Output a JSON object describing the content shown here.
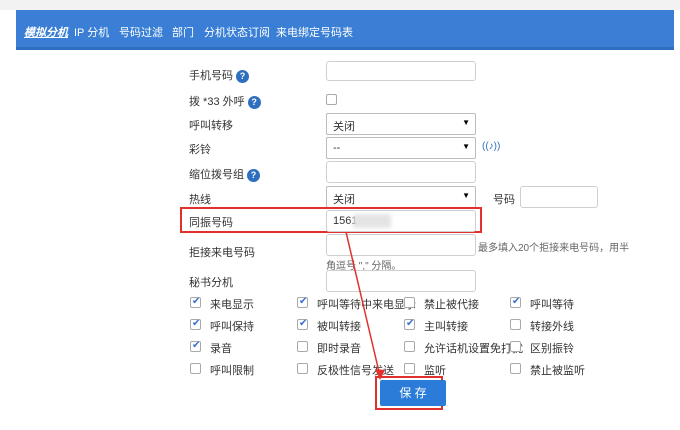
{
  "nav": {
    "items": [
      {
        "label": "模拟分机",
        "active": true
      },
      {
        "label": "IP 分机",
        "active": false
      },
      {
        "label": "号码过滤",
        "active": false
      },
      {
        "label": "部门",
        "active": false
      },
      {
        "label": "分机状态订阅",
        "active": false
      },
      {
        "label": "来电绑定号码表",
        "active": false
      }
    ]
  },
  "form": {
    "mobile": {
      "label": "手机号码",
      "value": ""
    },
    "dial33": {
      "label": "拨 *33 外呼",
      "checked": false
    },
    "forward": {
      "label": "呼叫转移",
      "value": "关闭"
    },
    "ringback": {
      "label": "彩铃",
      "value": "--"
    },
    "shortdial": {
      "label": "缩位拨号组",
      "value": ""
    },
    "hotline": {
      "label": "热线",
      "value": "关闭",
      "number_label": "号码",
      "number_value": ""
    },
    "simulring": {
      "label": "同振号码",
      "value": "1561"
    },
    "reject": {
      "label": "拒接来电号码",
      "value": "",
      "hint_line1": "最多填入20个拒接来电号码，用半",
      "hint_line2": "角逗号 \",\" 分隔。"
    },
    "secretary": {
      "label": "秘书分机",
      "value": ""
    }
  },
  "options": [
    [
      {
        "label": "来电显示",
        "checked": true
      },
      {
        "label": "呼叫等待中来电显示",
        "checked": true
      },
      {
        "label": "禁止被代接",
        "checked": false
      },
      {
        "label": "呼叫等待",
        "checked": true
      }
    ],
    [
      {
        "label": "呼叫保持",
        "checked": true
      },
      {
        "label": "被叫转接",
        "checked": true
      },
      {
        "label": "主叫转接",
        "checked": true
      },
      {
        "label": "转接外线",
        "checked": false
      }
    ],
    [
      {
        "label": "录音",
        "checked": true
      },
      {
        "label": "即时录音",
        "checked": false
      },
      {
        "label": "允许话机设置免打扰",
        "checked": false
      },
      {
        "label": "区别振铃",
        "checked": false
      }
    ],
    [
      {
        "label": "呼叫限制",
        "checked": false
      },
      {
        "label": "反极性信号发送",
        "checked": false
      },
      {
        "label": "监听",
        "checked": false
      },
      {
        "label": "禁止被监听",
        "checked": false
      }
    ]
  ],
  "save_label": "保 存",
  "colors": {
    "nav_bg": "#3a7fd5",
    "highlight": "#e0312f",
    "button": "#2b7bd9"
  },
  "icons": {
    "help": "help-icon",
    "ringback": "sound-wave-icon"
  }
}
